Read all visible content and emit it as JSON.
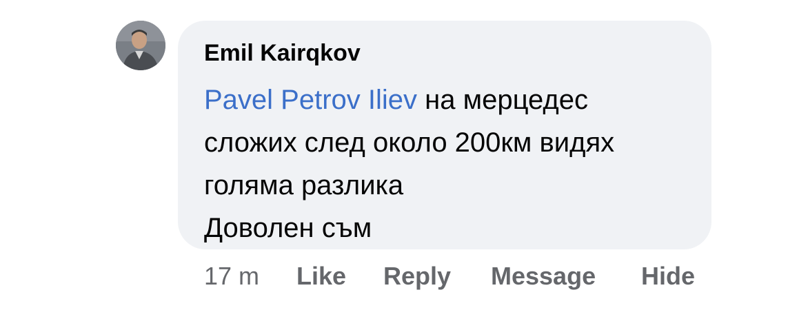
{
  "comment": {
    "author": "Emil Kairqkov",
    "mention": "Pavel Petrov Iliev",
    "line1_rest": " на мерцедес",
    "line2": "сложих след около 200км видях",
    "line3": "голяма разлика",
    "line4": "Доволен съм"
  },
  "actions": {
    "time": "17 m",
    "like": "Like",
    "reply": "Reply",
    "message": "Message",
    "hide": "Hide"
  },
  "colors": {
    "bubble_bg": "#f0f2f5",
    "mention": "#3b6fc9",
    "action_text": "#65676b",
    "text": "#050505"
  },
  "icons": {
    "avatar": "user-profile-photo"
  }
}
